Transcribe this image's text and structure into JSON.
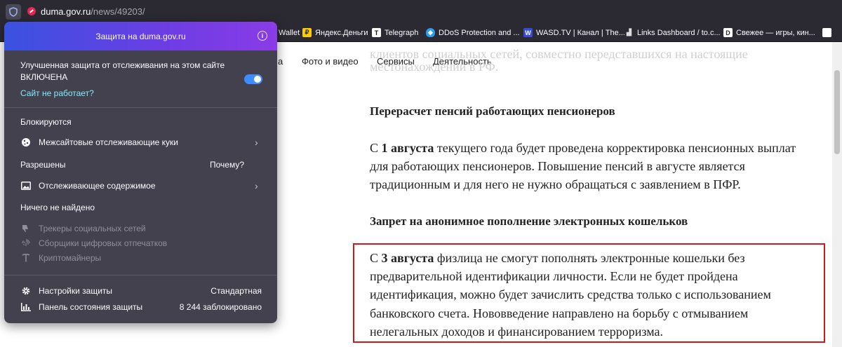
{
  "browser": {
    "url_host": "duma.gov.ru",
    "url_path": "/news/49203/"
  },
  "bookmarks": [
    {
      "label": "Wallet",
      "icon": "wallet-icon",
      "color": "#2b2a33"
    },
    {
      "label": "Яндекс.Деньги",
      "icon": "yandex-money-icon",
      "color": "#ffcc00"
    },
    {
      "label": "Telegraph",
      "icon": "telegraph-icon",
      "color": "#ffffff"
    },
    {
      "label": "DDoS Protection and ...",
      "icon": "ddos-shield-icon",
      "color": "#2a9df4"
    },
    {
      "label": "WASD.TV | Канал | The...",
      "icon": "wasd-icon",
      "color": "#3a4bd8"
    },
    {
      "label": "Links Dashboard / to.c...",
      "icon": "links-icon",
      "color": "#2b2a33"
    },
    {
      "label": "Свежее — игры, кин...",
      "icon": "dtf-icon",
      "color": "#ffffff"
    }
  ],
  "site_nav": {
    "partial": "а",
    "photo_video": "Фото и видео",
    "services": "Сервисы",
    "activity": "Деятельность"
  },
  "article": {
    "ghost_lines": [
      "клиентов социальных сетей, совместно передставшихся на настоящие",
      "местонахождении в РФ."
    ],
    "heading1": "Перерасчет пенсий работающих пенсионеров",
    "p1_prefix": "С ",
    "p1_bold": "1 августа",
    "p1_line1_rest": " текущего года будет проведена корректировка пенсионных выплат",
    "p1_line2": "для работающих пенсионеров. Повышение пенсий в августе является",
    "p1_line3": "традиционным и для него не нужно обращаться с заявлением в ПФР.",
    "heading2": "Запрет на анонимное пополнение электронных кошельков",
    "p2_prefix": "С ",
    "p2_bold": "3 августа",
    "p2_line1_rest": " физлица не смогут пополнять электронные кошельки без",
    "p2_line2": "предварительной идентификации личности. Если не будет пройдена",
    "p2_line3": "идентификация, можно будет зачислить средства только с использованием",
    "p2_line4": "банковского счета. Нововведение направлено на борьбу с отмыванием",
    "p2_line5": "нелегальных доходов и финансированием терроризма."
  },
  "popup": {
    "title": "Защита на duma.gov.ru",
    "status_line1": "Улучшенная защита от отслеживания на этом сайте",
    "status_line2": "ВКЛЮЧЕНА",
    "site_broken": "Сайт не работает?",
    "toggle_on": true,
    "blocked_heading": "Блокируются",
    "blocked_item": "Межсайтовые отслеживающие куки",
    "allowed_heading": "Разрешены",
    "why": "Почему?",
    "allowed_item": "Отслеживающее содержимое",
    "none_found_heading": "Ничего не найдено",
    "none_items": [
      "Трекеры социальных сетей",
      "Сборщики цифровых отпечатков",
      "Криптомайнеры"
    ],
    "settings_label": "Настройки защиты",
    "settings_value": "Стандартная",
    "dashboard_label": "Панель состояния защиты",
    "dashboard_value": "8 244 заблокировано",
    "colors": {
      "accent_toggle": "#3e8cff",
      "link": "#80ebff",
      "highlight_box": "#d0191f"
    }
  }
}
